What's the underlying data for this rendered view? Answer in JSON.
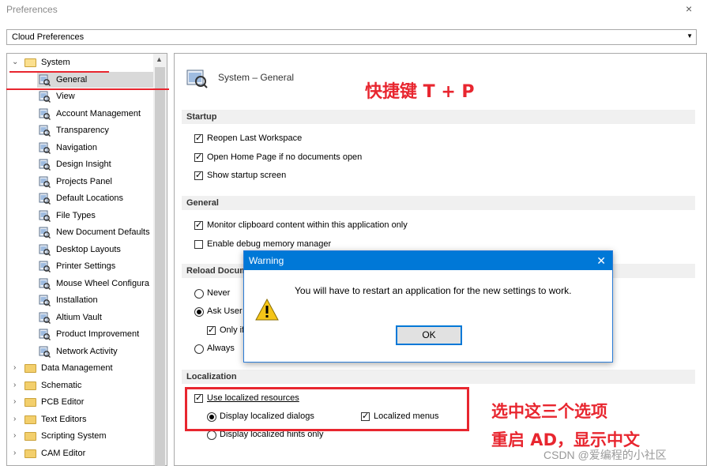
{
  "window": {
    "title": "Preferences",
    "close_label": "×"
  },
  "combo": {
    "value": "Cloud Preferences"
  },
  "tree": {
    "root": {
      "label": "System"
    },
    "children": [
      "General",
      "View",
      "Account Management",
      "Transparency",
      "Navigation",
      "Design Insight",
      "Projects Panel",
      "Default Locations",
      "File Types",
      "New Document Defaults",
      "Desktop Layouts",
      "Printer Settings",
      "Mouse Wheel Configura",
      "Installation",
      "Altium Vault",
      "Product Improvement",
      "Network Activity"
    ],
    "folders": [
      "Data Management",
      "Schematic",
      "PCB Editor",
      "Text Editors",
      "Scripting System",
      "CAM Editor"
    ]
  },
  "panel": {
    "header": "System – General",
    "startup": {
      "title": "Startup",
      "items": [
        "Reopen Last Workspace",
        "Open Home Page if no documents open",
        "Show startup screen"
      ]
    },
    "general": {
      "title": "General",
      "items": [
        "Monitor clipboard content within this application only",
        "Enable debug memory manager"
      ]
    },
    "reload": {
      "title": "Reload Docum",
      "never": "Never",
      "ask": "Ask User",
      "only": "Only if",
      "always": "Always"
    },
    "localization": {
      "title": "Localization",
      "use": "Use localized resources",
      "dialogs": "Display localized dialogs",
      "menus": "Localized menus",
      "hints": "Display localized hints only"
    }
  },
  "dialog": {
    "title": "Warning",
    "close_label": "✕",
    "message": "You will have to restart an application for the new settings to work.",
    "ok_label": "OK"
  },
  "annotations": {
    "shortcut": "快捷键 T + P",
    "select_line1": "选中这三个选项",
    "select_line2": "重启 AD，显示中文",
    "watermark": "CSDN @爱编程的小社区"
  },
  "colors": {
    "accent": "#0078d7",
    "annotation": "#e8262f"
  }
}
